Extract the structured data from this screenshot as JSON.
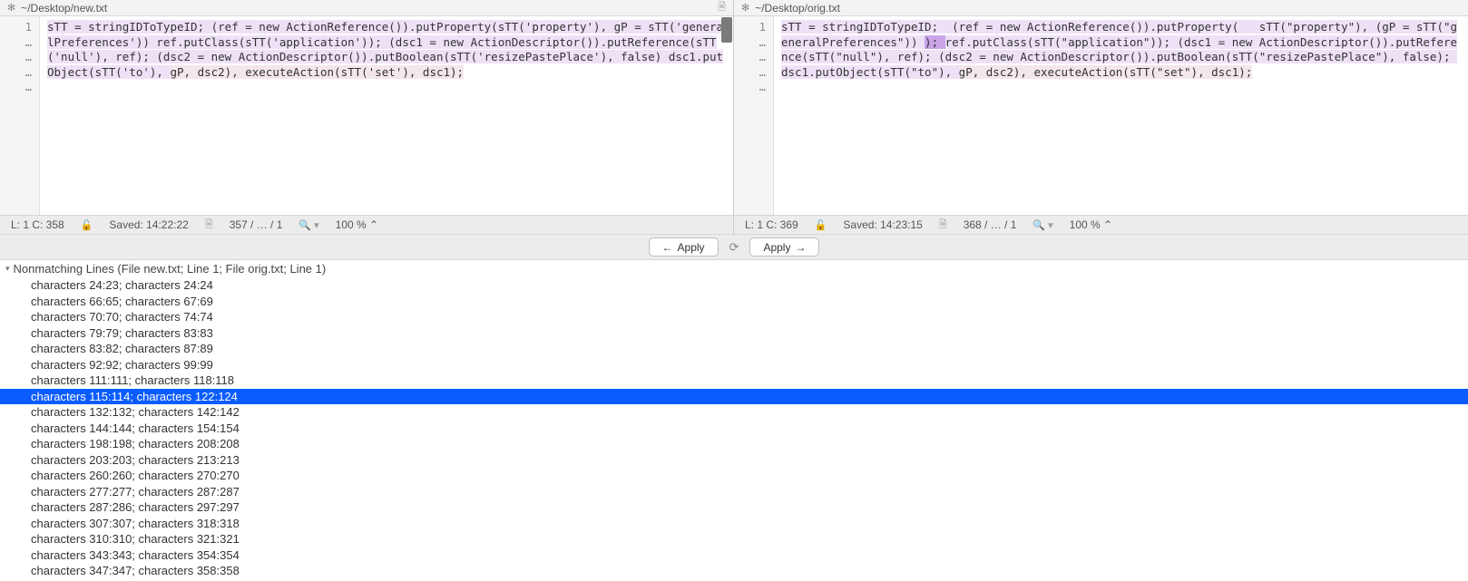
{
  "leftPane": {
    "title": "~/Desktop/new.txt",
    "gutter": [
      "1",
      "…",
      "…",
      "…",
      "…"
    ],
    "lines": [
      {
        "text": "sTT = stringIDToTypeID; (ref = new ActionReference()).putProperty(sTT('property'), gP = ",
        "cls": "hl-block"
      },
      {
        "text": "sTT('generalPreferences')) ref.putClass(sTT('application')); (dsc1 = new ",
        "cls": "hl-block"
      },
      {
        "text": "ActionDescriptor()).putReference(sTT('null'), ref); (dsc2 = new ",
        "cls": "hl-block"
      },
      {
        "text": "ActionDescriptor()).putBoolean(sTT('resizePastePlace'), false) dsc1.putObject(sTT('to'), ",
        "cls": "hl-block"
      },
      {
        "text": "gP, dsc2), executeAction(sTT('set'), dsc1);",
        "cls": "hl-final"
      }
    ],
    "status": {
      "cursor": "L: 1 C: 358",
      "saved": "Saved: 14:22:22",
      "pages": "357 / … / 1",
      "zoom": "100 %"
    }
  },
  "rightPane": {
    "title": "~/Desktop/orig.txt",
    "gutter": [
      "1",
      "…",
      "…",
      "…",
      "…"
    ],
    "pre": "sTT = stringIDToTypeID;  (ref = new ActionReference()).putProperty(   sTT(\"property\"), (gP = sTT(\"generalPreferences\")) ",
    "sel": "); ",
    "post": "ref.putClass(sTT(\"application\")); (dsc1 = new ActionDescriptor()).putReference(sTT(\"null\"), ref); (dsc2 = new ActionDescriptor()).putBoolean(sTT(\"resizePastePlace\"), false); dsc1.putObject(sTT(\"to\"), ",
    "tail": "gP, dsc2), executeAction(sTT(\"set\"), dsc1);",
    "status": {
      "cursor": "L: 1 C: 369",
      "saved": "Saved: 14:23:15",
      "pages": "368 / … / 1",
      "zoom": "100 %"
    }
  },
  "toolbar": {
    "applyLeft": "Apply",
    "applyRight": "Apply"
  },
  "results": {
    "header": "Nonmatching Lines (File new.txt; Line 1; File orig.txt; Line 1)",
    "items": [
      "characters 24:23; characters 24:24",
      "characters 66:65; characters 67:69",
      "characters 70:70; characters 74:74",
      "characters 79:79; characters 83:83",
      "characters 83:82; characters 87:89",
      "characters 92:92; characters 99:99",
      "characters 111:111; characters 118:118",
      "characters 115:114; characters 122:124",
      "characters 132:132; characters 142:142",
      "characters 144:144; characters 154:154",
      "characters 198:198; characters 208:208",
      "characters 203:203; characters 213:213",
      "characters 260:260; characters 270:270",
      "characters 277:277; characters 287:287",
      "characters 287:286; characters 297:297",
      "characters 307:307; characters 318:318",
      "characters 310:310; characters 321:321",
      "characters 343:343; characters 354:354",
      "characters 347:347; characters 358:358"
    ],
    "selectedIndex": 7
  }
}
